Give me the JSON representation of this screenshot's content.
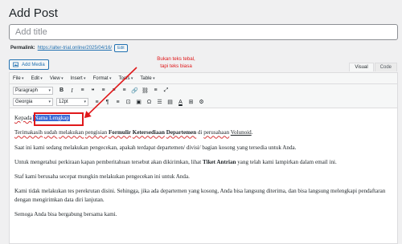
{
  "page": {
    "title": "Add Post",
    "title_placeholder": "Add title"
  },
  "permalink": {
    "label": "Permalink:",
    "url": "https://alter-trial.online/2025/04/16/",
    "edit_label": "Edit"
  },
  "media": {
    "add_media_label": "Add Media"
  },
  "editor_tabs": [
    {
      "label": "Visual",
      "active": true
    },
    {
      "label": "Code",
      "active": false
    }
  ],
  "menubar": [
    "File",
    "Edit",
    "View",
    "Insert",
    "Format",
    "Tools",
    "Table"
  ],
  "toolbar": {
    "paragraph_select": "Paragraph",
    "font_select": "Georgia",
    "size_select": "12pt",
    "buttons_row1": [
      "B",
      "I",
      "≡",
      "❝",
      "≡",
      "≡",
      "≡",
      "🔗",
      "⛓",
      "≡",
      "⤢"
    ],
    "buttons_row2": [
      "≡",
      "¶",
      "≡",
      "⊡",
      "▣",
      "Ω",
      "☰",
      "▤",
      "A",
      "⊞",
      "⚙"
    ]
  },
  "content": {
    "p1_prefix": "Kepada",
    "p1_highlight": "Nama Lengkap",
    "p2": {
      "word1": "Terimakasih",
      "t1": " ",
      "word2": "sudah",
      "t2": " ",
      "word3": "melakukan",
      "t3": " ",
      "word4": "pengisian",
      "t4": " ",
      "bold1": "Formulir",
      "t5": " ",
      "bold2": "Ketersediaan",
      "t6": " ",
      "bold3": "Departemen",
      "t7": " di ",
      "word5": "perusahaan",
      "t8": " ",
      "word6": "Volunoid",
      "t9": "."
    },
    "p3": "Saat ini kami sedang melakukan pengecekan, apakah terdapat departemen/ divisi/ bagian kosong yang tersedia untuk Anda.",
    "p4_before": "Untuk mengetahui perkiraan kapan pemberitahuan tersebut akan dikirimkan, lihat ",
    "p4_bold": "Tiket Antrian",
    "p4_after": " yang telah kami lampirkan dalam email ini.",
    "p5": "Staf kami berusaha secepat mungkin melakukan pengecekan ini untuk Anda.",
    "p6": "Kami tidak melakukan tes perekrutan disini. Sehingga, jika ada departemen yang kosong, Anda bisa langsung diterima, dan bisa langsung melengkapi pendaftaran dengan mengirimkan data diri lanjutan.",
    "p7": "Semoga Anda bisa bergabung bersama kami."
  },
  "annotation": {
    "line1": "Bukan teks tebal,",
    "line2": "tapi teks biasa",
    "color": "#e0191b"
  },
  "colors": {
    "accent": "#2271b1",
    "highlight": "#3a6ad6"
  }
}
